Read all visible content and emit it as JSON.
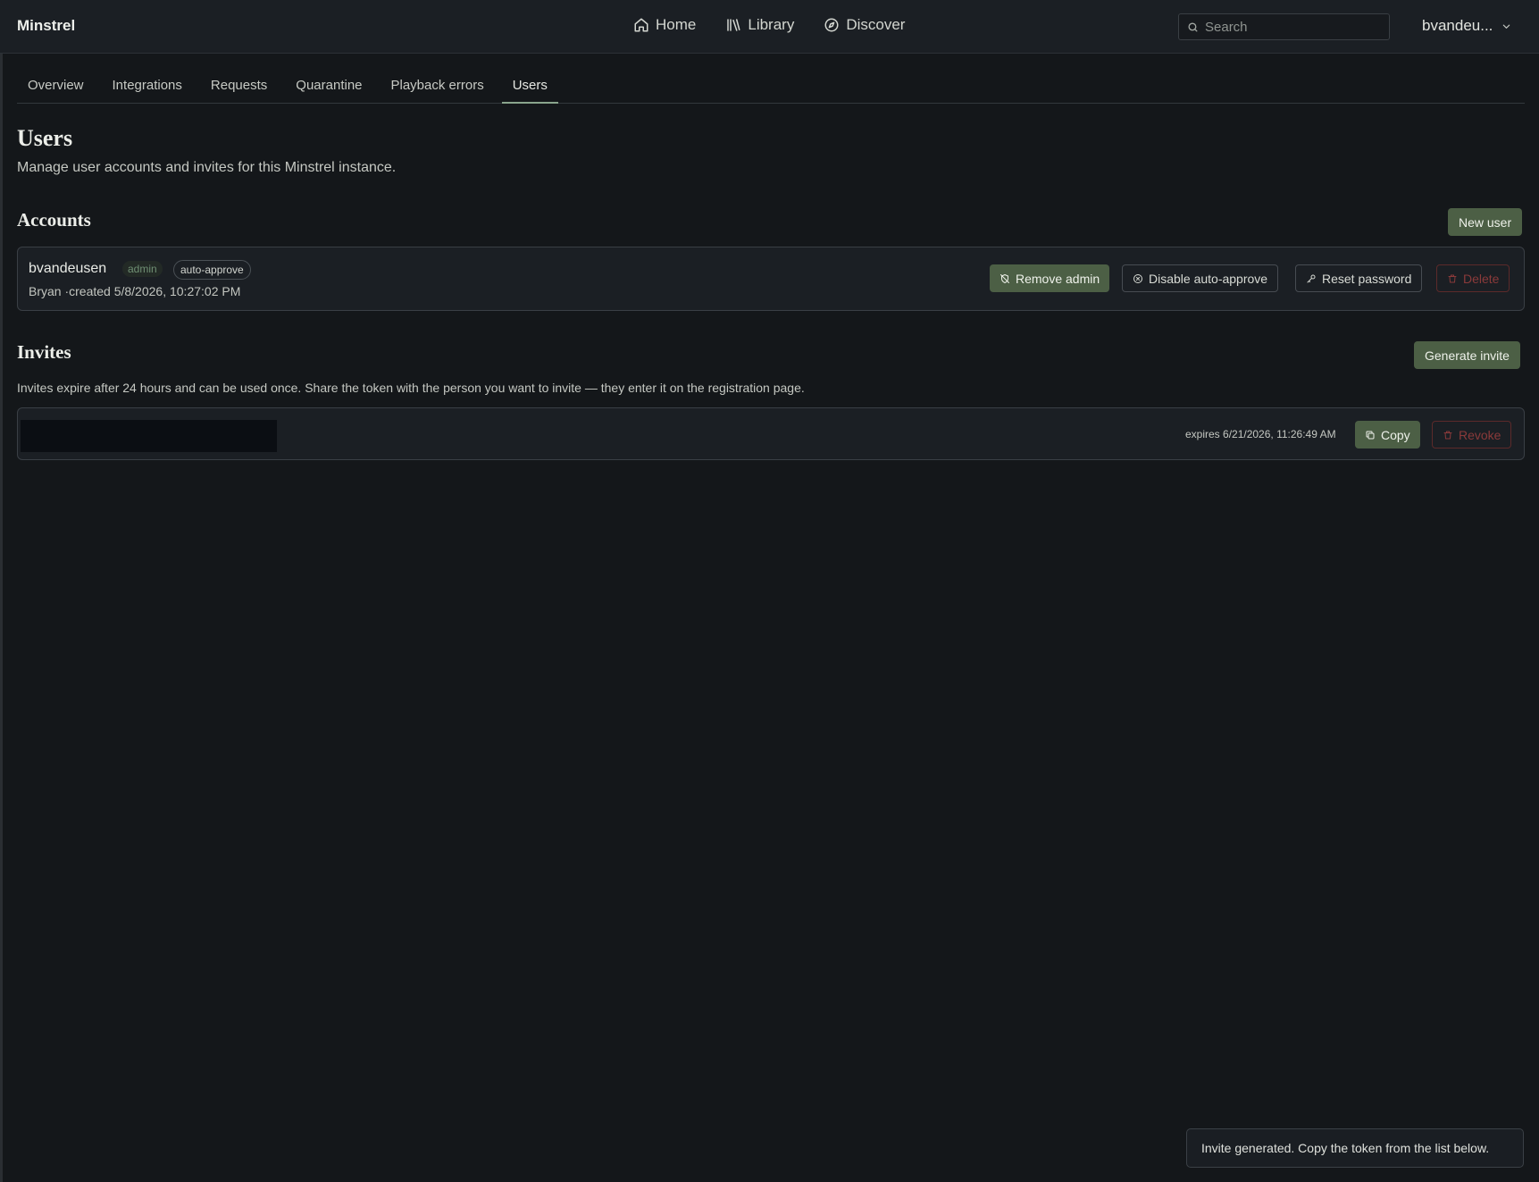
{
  "app": {
    "title": "Minstrel"
  },
  "nav": {
    "items": [
      {
        "label": "Home",
        "icon": "home-icon"
      },
      {
        "label": "Library",
        "icon": "library-icon"
      },
      {
        "label": "Discover",
        "icon": "compass-icon"
      }
    ]
  },
  "search": {
    "placeholder": "Search",
    "value": ""
  },
  "user": {
    "name": "bvandeu..."
  },
  "tabs": [
    "Overview",
    "Integrations",
    "Requests",
    "Quarantine",
    "Playback errors",
    "Users"
  ],
  "active_tab": "Users",
  "page": {
    "title": "Users",
    "subtitle": "Manage user accounts and invites for this Minstrel instance."
  },
  "accounts": {
    "title": "Accounts",
    "new_user_label": "New user",
    "items": [
      {
        "username": "bvandeusen",
        "badge_admin": "admin",
        "badge_auto": "auto-approve",
        "meta": "Bryan ·created 5/8/2026, 10:27:02 PM",
        "actions": {
          "remove_admin": "Remove admin",
          "disable_auto": "Disable auto-approve",
          "reset_password": "Reset password",
          "delete": "Delete"
        }
      }
    ]
  },
  "invites": {
    "title": "Invites",
    "generate_label": "Generate invite",
    "note": "Invites expire after 24 hours and can be used once. Share the token with the person you want to invite — they enter it on the registration page.",
    "items": [
      {
        "expires": "expires 6/21/2026, 11:26:49 AM",
        "copy_label": "Copy",
        "revoke_label": "Revoke"
      }
    ]
  },
  "toast": {
    "message": "Invite generated. Copy the token from the list below."
  },
  "colors": {
    "background": "#14171a",
    "topbar": "#1b1f24",
    "accent_green": "#4c5f45",
    "danger": "#8a3a3a",
    "tab_indicator": "#8aa58d"
  }
}
